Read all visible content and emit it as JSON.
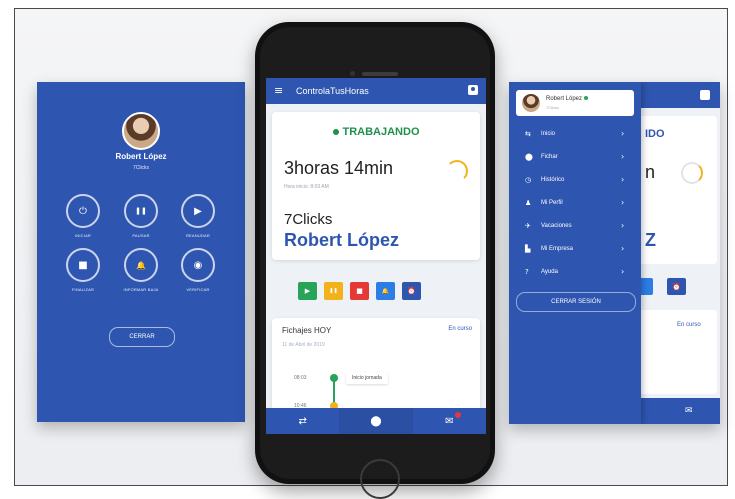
{
  "left_screen": {
    "user_name": "Robert López",
    "company": "7Clicks",
    "buttons": [
      {
        "label": "INICIAR",
        "icon": "⏻"
      },
      {
        "label": "PAUSAR",
        "icon": "❚❚"
      },
      {
        "label": "REANUDAR",
        "icon": "▶"
      },
      {
        "label": "FINALIZAR",
        "icon": "■"
      },
      {
        "label": "INFORMAR BAJA",
        "icon": "🔔"
      },
      {
        "label": "VERIFICAR",
        "icon": "◉"
      }
    ],
    "close_label": "CERRAR"
  },
  "phone": {
    "app_title": "ControlaTusHoras",
    "menu_icon": "≡",
    "status": "TRABAJANDO",
    "hours": "3horas 14min",
    "start_time": "Hora inicio: 8:03 AM",
    "company": "7Clicks",
    "worker": "Robert López",
    "actions": [
      {
        "icon": "▶",
        "color": "#27a35a"
      },
      {
        "icon": "❚❚",
        "color": "#f2b21b"
      },
      {
        "icon": "■",
        "color": "#e53935"
      },
      {
        "icon": "🔔",
        "color": "#2e7ce6"
      },
      {
        "icon": "⏰",
        "color": "#2e56b0"
      }
    ],
    "fichajes_title": "Fichajes HOY",
    "fichajes_status": "En curso",
    "fichajes_date": "11 de Abril de 2019",
    "timeline": [
      {
        "time": "08:03",
        "event": "Inicio jornada"
      },
      {
        "time": "10:46"
      }
    ],
    "bottom_nav": [
      {
        "icon": "⇄"
      },
      {
        "icon": "⬤"
      },
      {
        "icon": "✉"
      }
    ]
  },
  "right_screen": {
    "drawer_user": "Robert López",
    "drawer_sub": "7Clicks",
    "menu_items": [
      {
        "label": "Inicio",
        "icon": "⇆"
      },
      {
        "label": "Fichar",
        "icon": "⬤"
      },
      {
        "label": "Histórico",
        "icon": "◷"
      },
      {
        "label": "Mi Perfil",
        "icon": "♟"
      },
      {
        "label": "Vacaciones",
        "icon": "✈"
      },
      {
        "label": "Mi Empresa",
        "icon": "▙"
      },
      {
        "label": "Ayuda",
        "icon": "?"
      }
    ],
    "chevron": "›",
    "logout_label": "CERRAR SESIÓN",
    "bg_status_fragment": "IDO",
    "bg_hours_fragment": "n",
    "bg_name_fragment": "Z",
    "bg_fichajes_status": "En curso",
    "alarm_icon": "⏰",
    "mail_icon": "✉"
  },
  "colors": {
    "primary": "#2e56b0",
    "working": "#1f8f4e",
    "accent_yellow": "#f2b21b"
  }
}
